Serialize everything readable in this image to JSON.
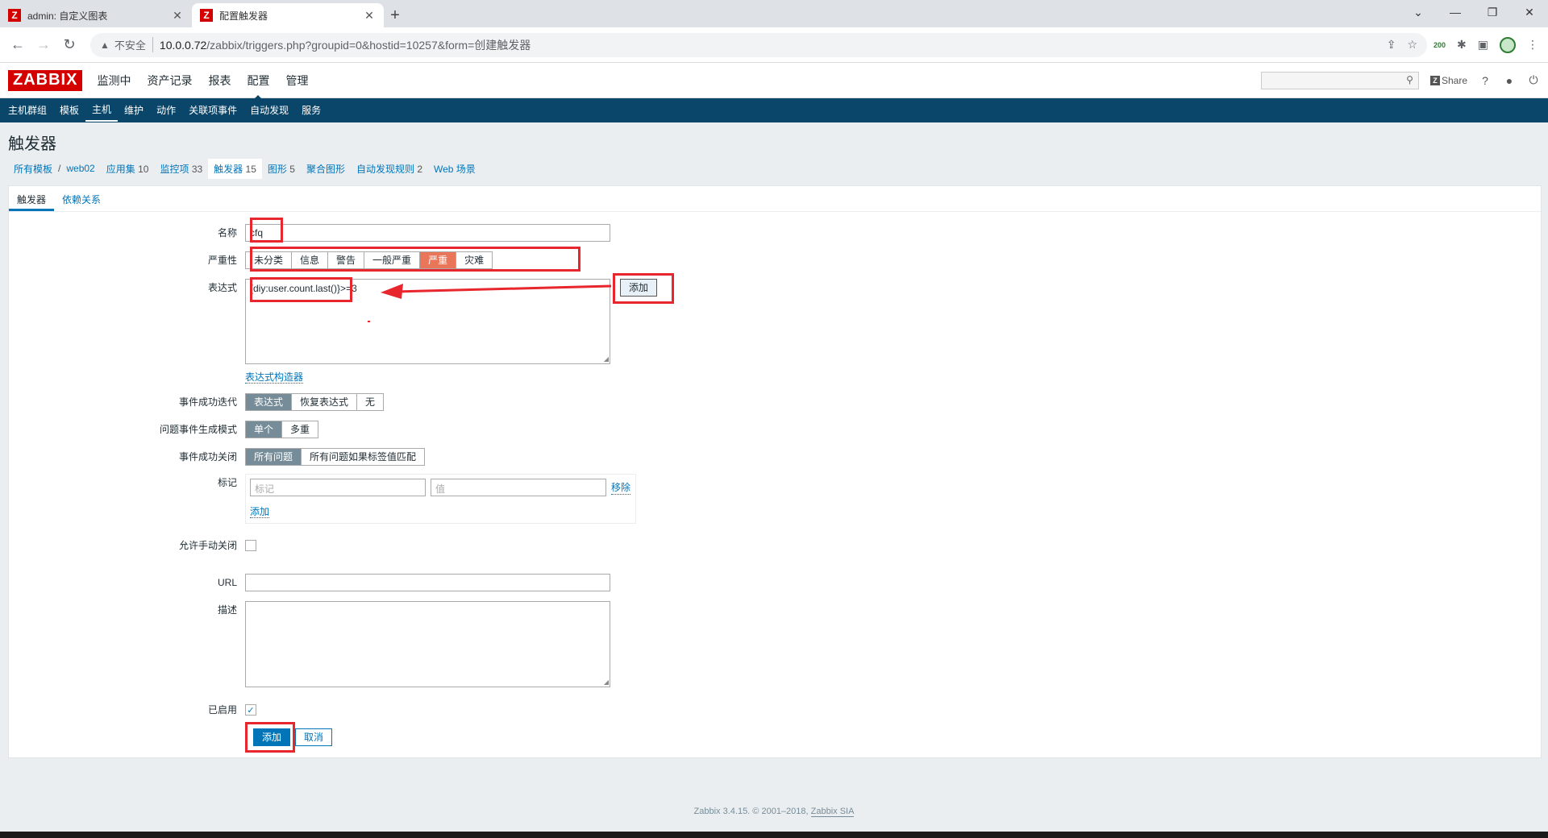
{
  "browser": {
    "tabs": [
      {
        "favicon": "Z",
        "title": "admin: 自定义图表"
      },
      {
        "favicon": "Z",
        "title": "配置触发器"
      }
    ],
    "insecure_label": "不安全",
    "url_host": "10.0.0.72",
    "url_path": "/zabbix/triggers.php?groupid=0&hostid=10257&form=创建触发器",
    "ext_badge": "200"
  },
  "zabbix": {
    "logo": "ZABBIX",
    "top_menu": [
      "监测中",
      "资产记录",
      "报表",
      "配置",
      "管理"
    ],
    "share_label": "Share",
    "sub_menu": [
      "主机群组",
      "模板",
      "主机",
      "维护",
      "动作",
      "关联项事件",
      "自动发现",
      "服务"
    ],
    "page_title": "触发器",
    "breadcrumbs": {
      "all_templates": "所有模板",
      "host": "web02",
      "apps": "应用集",
      "apps_count": "10",
      "items": "监控项",
      "items_count": "33",
      "triggers": "触发器",
      "triggers_count": "15",
      "graphs": "图形",
      "graphs_count": "5",
      "screens": "聚合图形",
      "discovery": "自动发现规则",
      "discovery_count": "2",
      "web": "Web 场景"
    },
    "form_tabs": [
      "触发器",
      "依赖关系"
    ],
    "form": {
      "name_label": "名称",
      "name_value": "cfq",
      "severity_label": "严重性",
      "severities": [
        "未分类",
        "信息",
        "警告",
        "一般严重",
        "严重",
        "灾难"
      ],
      "selected_severity": "严重",
      "expression_label": "表达式",
      "expression_value": "{diy:user.count.last()}>=3",
      "expression_add": "添加",
      "expression_builder": "表达式构造器",
      "ok_event_gen_label": "事件成功迭代",
      "ok_event_gen": [
        "表达式",
        "恢复表达式",
        "无"
      ],
      "problem_mode_label": "问题事件生成模式",
      "problem_mode": [
        "单个",
        "多重"
      ],
      "ok_close_label": "事件成功关闭",
      "ok_close": [
        "所有问题",
        "所有问题如果标签值匹配"
      ],
      "tags_label": "标记",
      "tag_placeholder": "标记",
      "value_placeholder": "值",
      "tag_remove": "移除",
      "tag_add": "添加",
      "manual_close_label": "允许手动关闭",
      "url_label": "URL",
      "description_label": "描述",
      "enabled_label": "已启用",
      "submit": "添加",
      "cancel": "取消"
    },
    "footer": "Zabbix 3.4.15. © 2001–2018,",
    "footer_link": "Zabbix SIA"
  },
  "annotation_color": "#e8262d"
}
